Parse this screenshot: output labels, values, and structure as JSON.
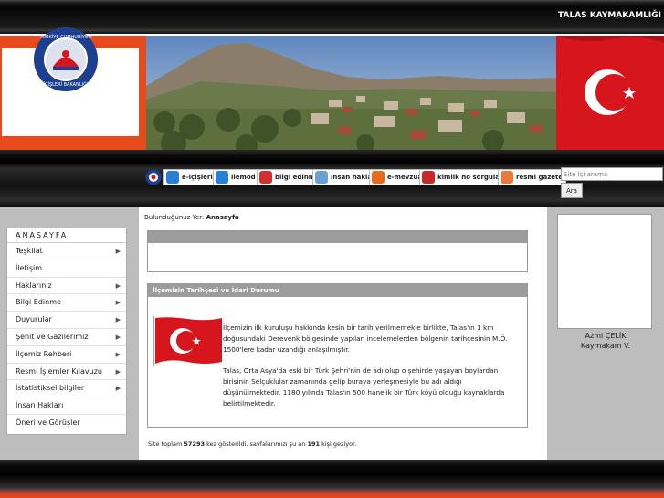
{
  "header": {
    "site_title": "TALAS KAYMAKAMLIĞI"
  },
  "banner": {
    "logo_top_text": "TÜRKİYE CUMHURİYETİ",
    "logo_bottom_text": "İÇİŞLERİ BAKANLIĞI"
  },
  "quicklinks": [
    {
      "label": "e-içişleri",
      "icon": "globe-icon",
      "color": "#2a7fd4"
    },
    {
      "label": "ilemod",
      "icon": "globe-icon",
      "color": "#2a7fd4"
    },
    {
      "label": "bilgi edinme",
      "icon": "info-icon",
      "color": "#d03030"
    },
    {
      "label": "insan hakları",
      "icon": "scales-icon",
      "color": "#6aa0d8"
    },
    {
      "label": "e-mevzuat",
      "icon": "book-icon",
      "color": "#e86a20"
    },
    {
      "label": "kimlik no sorgulama",
      "icon": "id-card-icon",
      "color": "#c82828"
    },
    {
      "label": "resmi gazete",
      "icon": "newspaper-icon",
      "color": "#e87a40"
    }
  ],
  "search": {
    "placeholder": "Site içi arama",
    "button_label": "Ara"
  },
  "menu": {
    "title": "ANASAYFA",
    "items": [
      {
        "label": "Teşkilat",
        "has_sub": true
      },
      {
        "label": "İletişim",
        "has_sub": false
      },
      {
        "label": "Haklarınız",
        "has_sub": true
      },
      {
        "label": "Bilgi Edinme",
        "has_sub": true
      },
      {
        "label": "Duyurular",
        "has_sub": true
      },
      {
        "label": "Şehit ve Gazilerimiz",
        "has_sub": true
      },
      {
        "label": "İlçemiz Rehberi",
        "has_sub": true
      },
      {
        "label": "Resmi İşlemler Kılavuzu",
        "has_sub": true
      },
      {
        "label": "İstatistiksel bilgiler",
        "has_sub": true
      },
      {
        "label": "İnsan Hakları",
        "has_sub": false
      },
      {
        "label": "Öneri ve Görüşler",
        "has_sub": false
      }
    ]
  },
  "breadcrumb": {
    "prefix": "Bulunduğunuz Yer:",
    "current": "Anasayfa"
  },
  "article": {
    "title": "İlçemizin Tarihçesi ve İdari Durumu",
    "paragraph1": "İlçemizin ilk kuruluşu hakkında kesin bir tarih verilmemekle birlikte, Talas'ın 1 km doğusundaki Derevenk bölgesinde yapılan incelemelerden bölgenin tarihçesinin M.Ö. 1500'lere kadar uzandığı anlaşılmıştır.",
    "paragraph2": "Talas, Orta Asya'da eski bir Türk Şehri'nin de adı olup o şehirde yaşayan boylardan birisinin Selçuklular zamanında gelip buraya yerleşmesiyle bu adı aldığı düşünülmektedir. 1180 yılında Talas'ın 500 hanelik bir Türk köyü olduğu kaynaklarda belirtilmektedir."
  },
  "stats": {
    "text1": "Site toplam",
    "total": "57293",
    "text2": "kez gösterildi. sayfalarımızı şu an",
    "online": "191",
    "text3": "kişi geziyor."
  },
  "kaymakam": {
    "name": "Azmi ÇELİK",
    "title": "Kaymakam V."
  }
}
